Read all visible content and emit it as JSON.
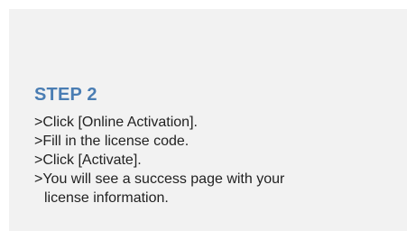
{
  "step": {
    "title": "STEP 2",
    "lines": [
      ">Click [Online Activation].",
      ">Fill in the license code.",
      ">Click [Activate].",
      ">You will see a success page with your",
      "license information."
    ]
  },
  "colors": {
    "card_background": "#f2f2f2",
    "title": "#4a7db3",
    "text": "#222222"
  }
}
